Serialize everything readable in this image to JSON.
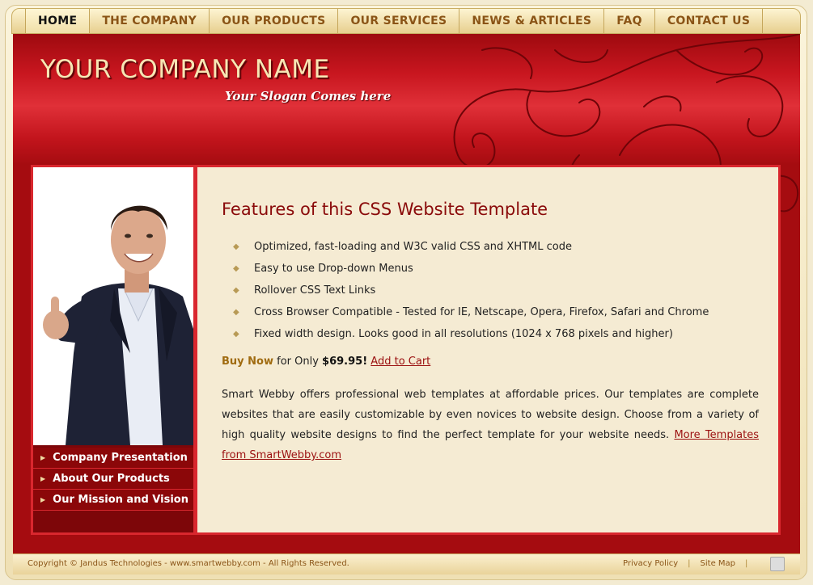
{
  "nav": {
    "items": [
      {
        "label": "HOME",
        "active": true
      },
      {
        "label": "THE COMPANY"
      },
      {
        "label": "OUR PRODUCTS"
      },
      {
        "label": "OUR SERVICES"
      },
      {
        "label": "NEWS & ARTICLES"
      },
      {
        "label": "FAQ"
      },
      {
        "label": "CONTACT US"
      }
    ]
  },
  "header": {
    "company_name": "YOUR COMPANY NAME",
    "slogan": "Your Slogan Comes here"
  },
  "sidebar": {
    "items": [
      {
        "label": "Company Presentation"
      },
      {
        "label": "About Our Products"
      },
      {
        "label": "Our Mission and Vision"
      }
    ]
  },
  "content": {
    "title": "Features of this CSS Website Template",
    "features": [
      "Optimized, fast-loading and W3C valid CSS and XHTML code",
      "Easy to use Drop-down Menus",
      "Rollover CSS Text Links",
      "Cross Browser Compatible - Tested for IE, Netscape, Opera, Firefox, Safari and Chrome",
      "Fixed width design. Looks good in all resolutions (1024 x 768 pixels and higher)"
    ],
    "buy": {
      "buy_now": "Buy Now",
      "for_only": " for Only ",
      "price": "$69.95!",
      "add_to_cart": "Add to Cart"
    },
    "description": "Smart Webby offers professional web templates at affordable prices. Our templates are complete websites that are easily customizable by even novices to website design. Choose from a variety of high quality website designs to find the perfect template for your website needs.",
    "more_link": "More Templates from SmartWebby.com"
  },
  "footer": {
    "copyright": "Copyright © Jandus Technologies - www.smartwebby.com - All Rights Reserved.",
    "privacy": "Privacy Policy",
    "separator": "|",
    "sitemap": "Site Map"
  },
  "colors": {
    "red": "#a50c10",
    "cream": "#f5ebd3",
    "gold": "#8a5416",
    "title_red": "#8a0a0a"
  }
}
